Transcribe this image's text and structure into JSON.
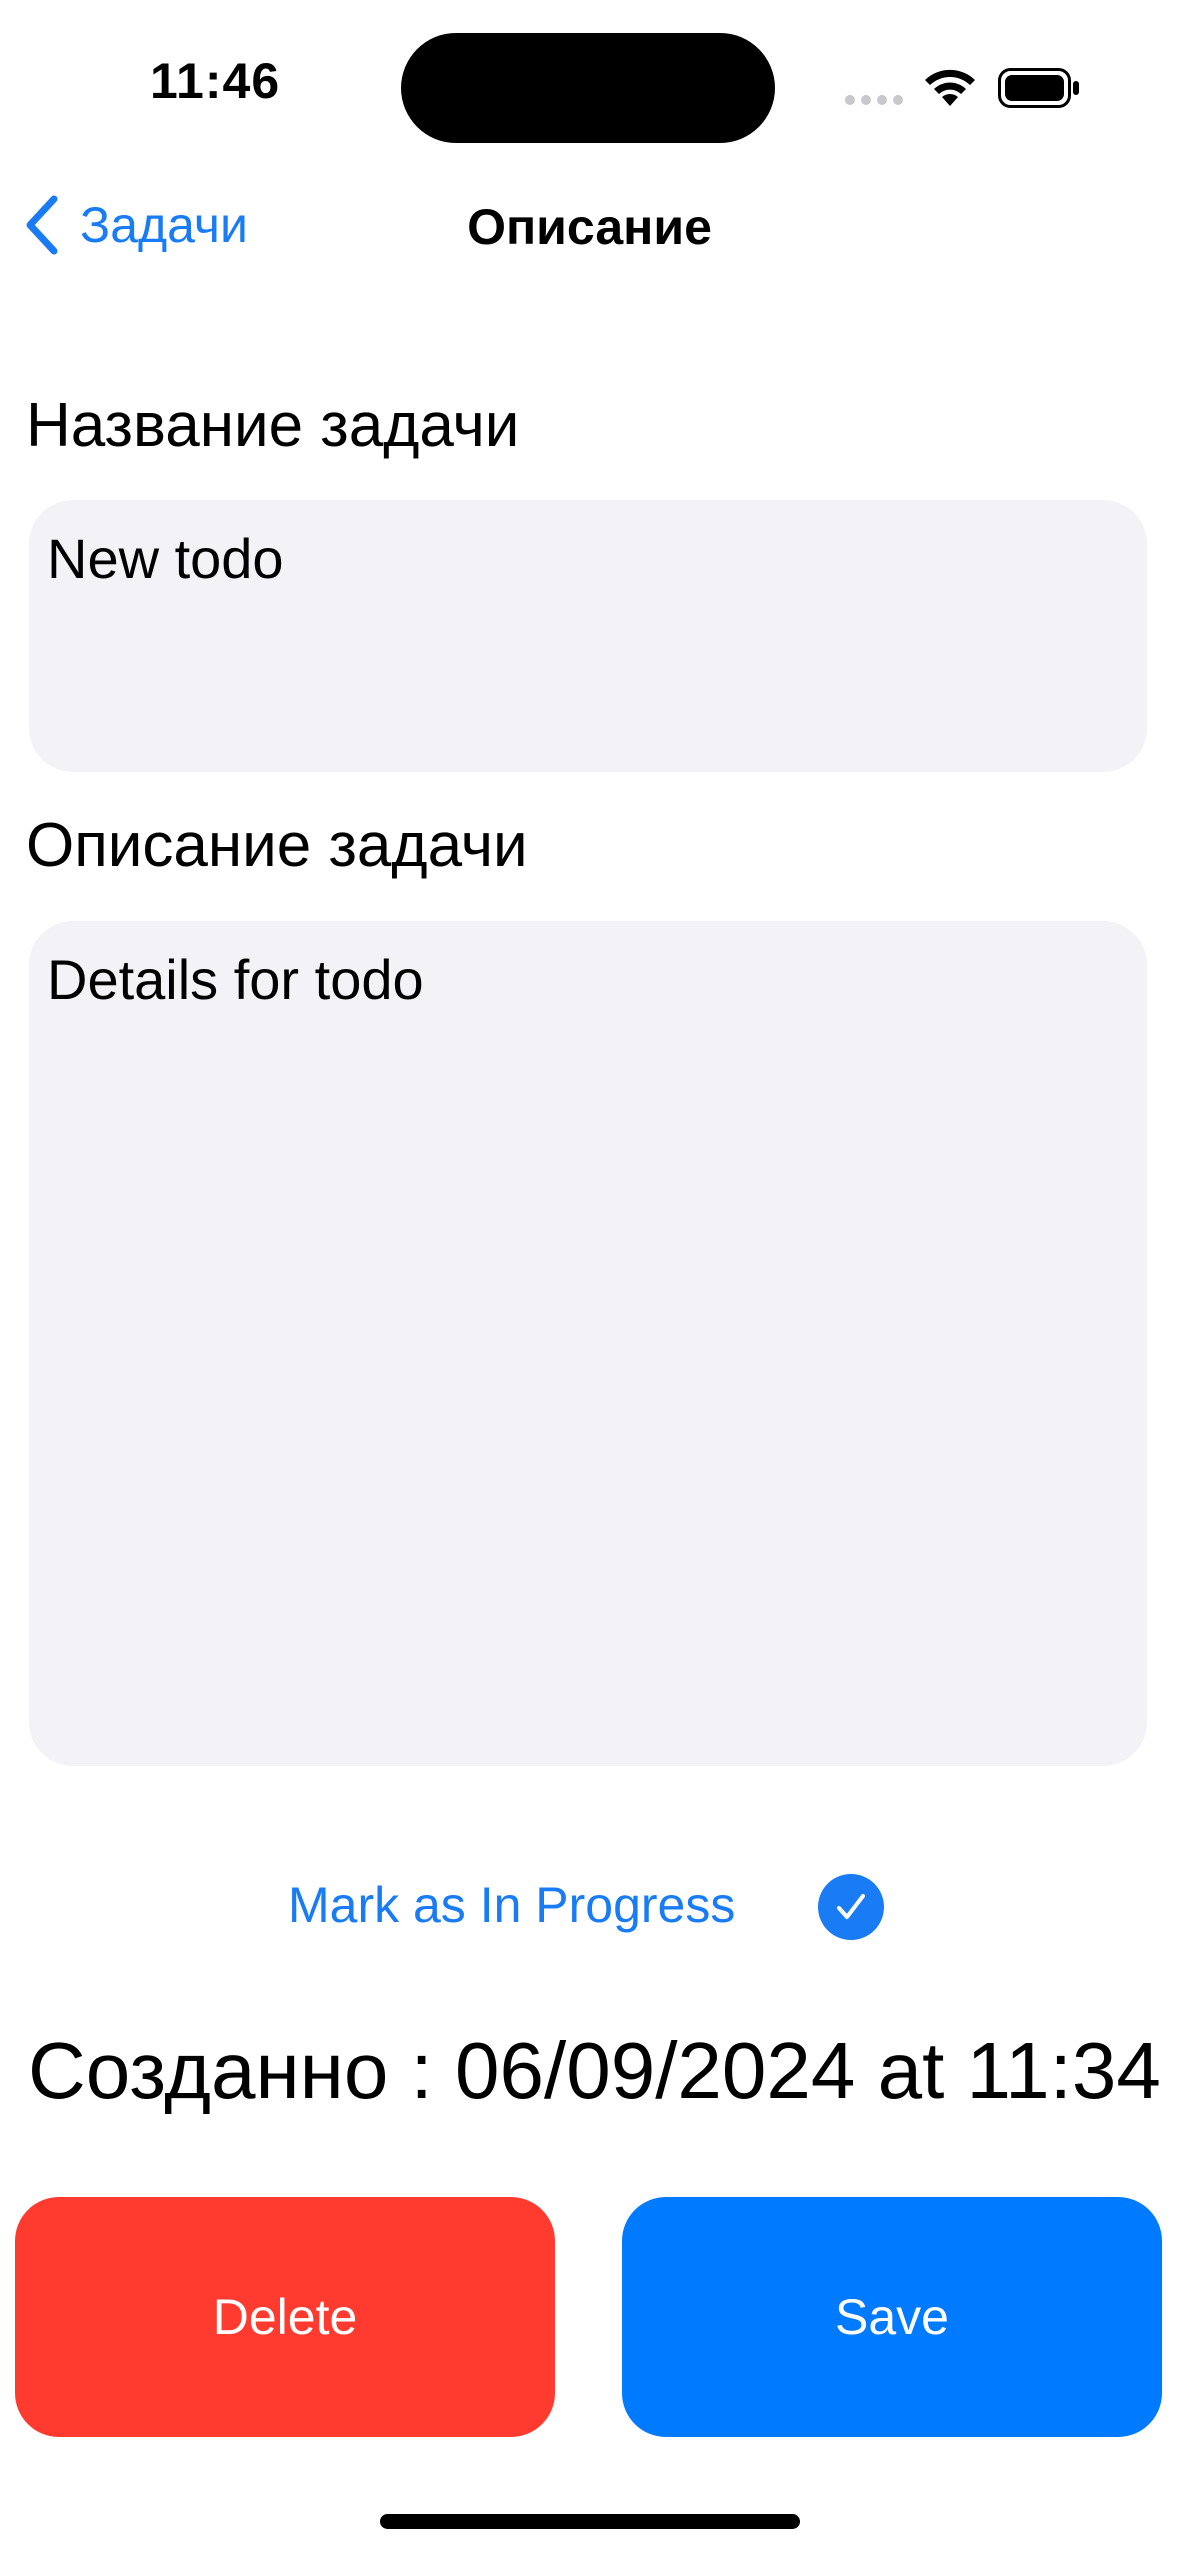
{
  "status_bar": {
    "time": "11:46"
  },
  "nav": {
    "back_label": "Задачи",
    "title": "Описание"
  },
  "form": {
    "title_label": "Название задачи",
    "title_value": "New todo",
    "description_label": "Описание задачи",
    "description_value": "Details for todo"
  },
  "toggle": {
    "label": "Mark as In Progress",
    "checked": true
  },
  "created": {
    "text": "Созданно : 06/09/2024 at 11:34"
  },
  "buttons": {
    "delete_label": "Delete",
    "save_label": "Save"
  },
  "colors": {
    "accent": "#1a7cf4",
    "delete": "#ff3b30",
    "save": "#007aff",
    "field_bg": "#f2f2f7"
  }
}
